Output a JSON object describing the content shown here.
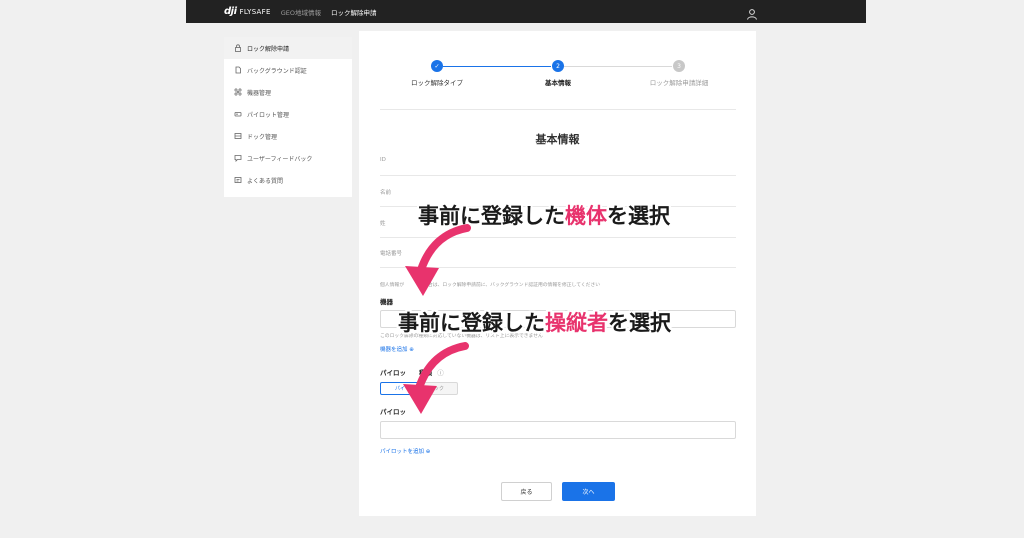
{
  "topbar": {
    "logo_mark": "dji",
    "logo_text": "FLYSAFE",
    "nav": [
      "GEO地域情報",
      "ロック解除申請"
    ],
    "user_icon": "user-icon"
  },
  "sidebar": {
    "items": [
      {
        "label": "ロック解除申請",
        "icon": "lock-icon"
      },
      {
        "label": "バックグラウンド認証",
        "icon": "document-icon"
      },
      {
        "label": "機器管理",
        "icon": "drone-icon"
      },
      {
        "label": "パイロット管理",
        "icon": "pilot-icon"
      },
      {
        "label": "ドック管理",
        "icon": "dock-icon"
      },
      {
        "label": "ユーザーフィードバック",
        "icon": "feedback-icon"
      },
      {
        "label": "よくある質問",
        "icon": "faq-icon"
      }
    ]
  },
  "stepper": {
    "steps": [
      {
        "num": "✓",
        "label": "ロック解除タイプ"
      },
      {
        "num": "2",
        "label": "基本情報"
      },
      {
        "num": "3",
        "label": "ロック解除申請詳細"
      }
    ]
  },
  "form": {
    "title": "基本情報",
    "fields": [
      "ID",
      "名前",
      "姓",
      "電話番号"
    ],
    "info_note": "個人情報が　　　　場合は、ロック解除申請前に、バックグラウンド認証用の情報を修正してください",
    "device_label": "機器",
    "device_note": "このロック解除の種類に対応していない機器は、リスト上に表示できません",
    "add_device": "機器を追加 ⊕",
    "pilot_type_label": "パイロッ　　種類",
    "pilot_type_info": "ⓘ",
    "pilot_type_options": [
      "パイ",
      "ック"
    ],
    "pilot_label": "パイロッ",
    "add_pilot": "パイロットを追加 ⊕",
    "back_button": "戻る",
    "next_button": "次へ"
  },
  "annotations": {
    "first": {
      "pre": "事前に登録した",
      "hl": "機体",
      "post": "を選択"
    },
    "second": {
      "pre": "事前に登録した",
      "hl": "操縦者",
      "post": "を選択"
    }
  },
  "colors": {
    "accent": "#1a73e8",
    "highlight": "#e8336d",
    "arrow": "#e8336d"
  }
}
